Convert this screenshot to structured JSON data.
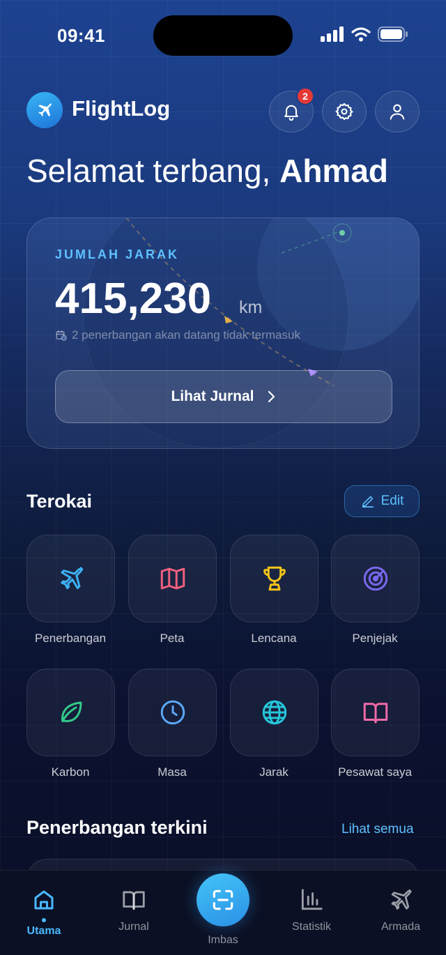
{
  "status": {
    "time": "09:41"
  },
  "header": {
    "app_name": "FlightLog",
    "notification_count": "2",
    "icons": [
      "plane-icon",
      "bell-icon",
      "gear-icon",
      "user-icon"
    ]
  },
  "greeting": {
    "prefix": "Selamat terbang, ",
    "name": "Ahmad"
  },
  "hero": {
    "label": "JUMLAH JARAK",
    "value": "415,230",
    "unit": "km",
    "note": "2 penerbangan akan datang tidak termasuk",
    "button_label": "Lihat Jurnal"
  },
  "explore": {
    "title": "Terokai",
    "edit_label": "Edit",
    "tiles": [
      {
        "label": "Penerbangan",
        "icon": "plane-icon",
        "color": "#3db2f5"
      },
      {
        "label": "Peta",
        "icon": "map-icon",
        "color": "#f0607f"
      },
      {
        "label": "Lencana",
        "icon": "trophy-icon",
        "color": "#f5c518"
      },
      {
        "label": "Penjejak",
        "icon": "radar-icon",
        "color": "#7b68ee"
      },
      {
        "label": "Karbon",
        "icon": "leaf-icon",
        "color": "#34c98a"
      },
      {
        "label": "Masa",
        "icon": "clock-icon",
        "color": "#5aa9f7"
      },
      {
        "label": "Jarak",
        "icon": "globe-icon",
        "color": "#26c6da"
      },
      {
        "label": "Pesawat saya",
        "icon": "book-icon",
        "color": "#f06aa8"
      }
    ]
  },
  "recent": {
    "title": "Penerbangan terkini",
    "see_all": "Lihat semua"
  },
  "tabbar": {
    "tabs": [
      {
        "label": "Utama",
        "icon": "home-icon",
        "active": true
      },
      {
        "label": "Jurnal",
        "icon": "book-icon",
        "active": false
      },
      {
        "label": "Imbas",
        "icon": "scan-icon",
        "active": false
      },
      {
        "label": "Statistik",
        "icon": "chart-icon",
        "active": false
      },
      {
        "label": "Armada",
        "icon": "plane-icon",
        "active": false
      }
    ]
  },
  "colors": {
    "accent": "#4ab8ff",
    "badge": "#e53935"
  }
}
